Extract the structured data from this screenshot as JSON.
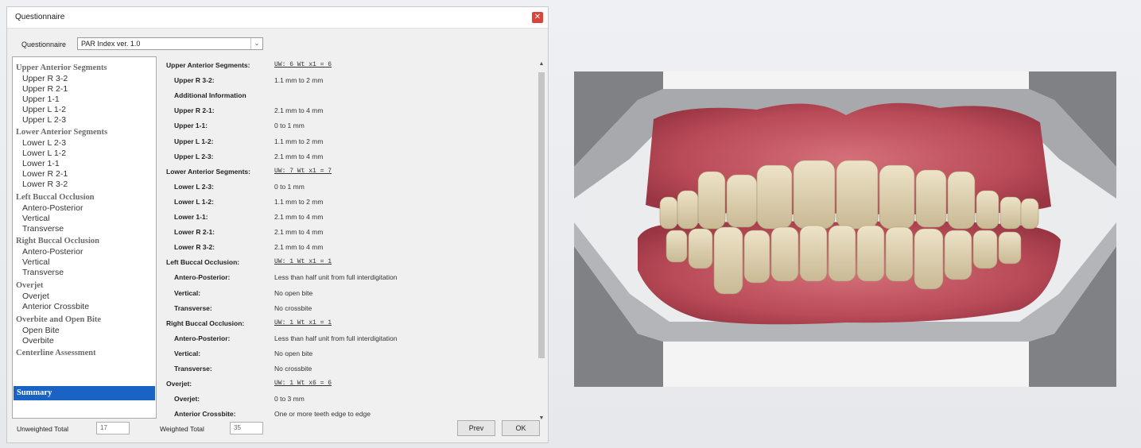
{
  "window": {
    "title": "Questionnaire",
    "close_glyph": "✕"
  },
  "questionnaire": {
    "label": "Questionnaire",
    "selected": "PAR Index ver. 1.0",
    "chevron": "⌄"
  },
  "tree": {
    "groups": [
      {
        "label": "Upper Anterior Segments",
        "items": [
          "Upper R 3-2",
          "Upper R 2-1",
          "Upper 1-1",
          "Upper L 1-2",
          "Upper L 2-3"
        ]
      },
      {
        "label": "Lower Anterior Segments",
        "items": [
          "Lower L 2-3",
          "Lower L 1-2",
          "Lower 1-1",
          "Lower R 2-1",
          "Lower R 3-2"
        ]
      },
      {
        "label": "Left Buccal Occlusion",
        "items": [
          "Antero-Posterior",
          "Vertical",
          "Transverse"
        ]
      },
      {
        "label": "Right Buccal Occlusion",
        "items": [
          "Antero-Posterior",
          "Vertical",
          "Transverse"
        ]
      },
      {
        "label": "Overjet",
        "items": [
          "Overjet",
          "Anterior Crossbite"
        ]
      },
      {
        "label": "Overbite and Open Bite",
        "items": [
          "Open Bite",
          "Overbite"
        ]
      },
      {
        "label": "Centerline Assessment",
        "items": []
      }
    ],
    "selected": "Summary"
  },
  "summary": {
    "rows": [
      {
        "label": "Upper Anterior Segments:",
        "value": "UW: 6  Wt x1 = 6",
        "heading": true
      },
      {
        "label": "Upper R 3-2:",
        "value": "1.1 mm to 2 mm"
      },
      {
        "label": "Additional Information",
        "value": ""
      },
      {
        "label": "Upper R 2-1:",
        "value": "2.1 mm to 4 mm"
      },
      {
        "label": "Upper 1-1:",
        "value": "0 to 1 mm"
      },
      {
        "label": "Upper L 1-2:",
        "value": "1.1 mm to 2 mm"
      },
      {
        "label": "Upper L 2-3:",
        "value": "2.1 mm to 4 mm"
      },
      {
        "label": "Lower Anterior Segments:",
        "value": "UW: 7  Wt x1 = 7",
        "heading": true
      },
      {
        "label": "Lower L 2-3:",
        "value": "0 to 1 mm"
      },
      {
        "label": "Lower L 1-2:",
        "value": "1.1 mm to 2 mm"
      },
      {
        "label": "Lower 1-1:",
        "value": "2.1 mm to 4 mm"
      },
      {
        "label": "Lower R 2-1:",
        "value": "2.1 mm to 4 mm"
      },
      {
        "label": "Lower R 3-2:",
        "value": "2.1 mm to 4 mm"
      },
      {
        "label": "Left Buccal Occlusion:",
        "value": "UW: 1  Wt x1 = 1",
        "heading": true
      },
      {
        "label": "Antero-Posterior:",
        "value": "Less than half unit from full interdigitation"
      },
      {
        "label": "Vertical:",
        "value": "No open bite"
      },
      {
        "label": "Transverse:",
        "value": "No crossbite"
      },
      {
        "label": "Right Buccal Occlusion:",
        "value": "UW: 1  Wt x1 = 1",
        "heading": true
      },
      {
        "label": "Antero-Posterior:",
        "value": "Less than half unit from full interdigitation"
      },
      {
        "label": "Vertical:",
        "value": "No open bite"
      },
      {
        "label": "Transverse:",
        "value": "No crossbite"
      },
      {
        "label": "Overjet:",
        "value": "UW: 1  Wt x6 = 6",
        "heading": true
      },
      {
        "label": "Overjet:",
        "value": "0 to 3 mm"
      },
      {
        "label": "Anterior Crossbite:",
        "value": "One or more teeth edge to edge"
      }
    ]
  },
  "footer": {
    "unweighted_label": "Unweighted Total",
    "unweighted_value": "17",
    "weighted_label": "Weighted Total",
    "weighted_value": "35",
    "prev_label": "Prev",
    "ok_label": "OK"
  },
  "scroll": {
    "up": "▲",
    "down": "▼"
  }
}
